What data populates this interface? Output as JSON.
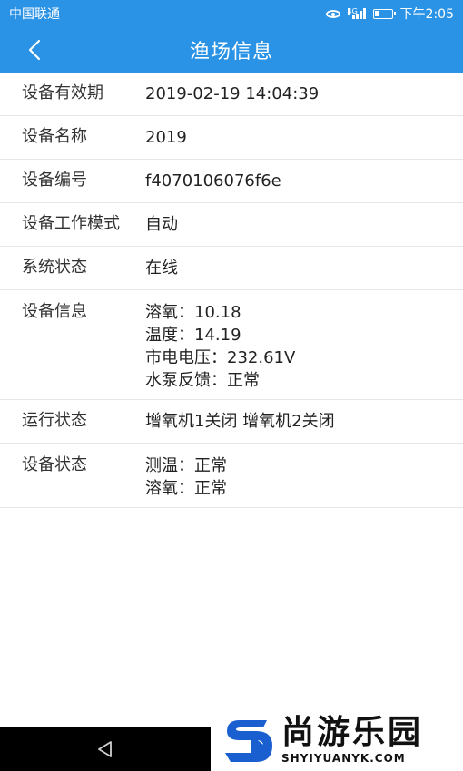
{
  "status_bar": {
    "carrier": "中国联通",
    "time": "下午2:05",
    "network": "4G"
  },
  "app_bar": {
    "title": "渔场信息",
    "back_icon": "chevron-left-icon"
  },
  "rows": [
    {
      "label": "设备有效期",
      "values": [
        "2019-02-19 14:04:39"
      ]
    },
    {
      "label": "设备名称",
      "values": [
        "2019"
      ]
    },
    {
      "label": "设备编号",
      "values": [
        "f4070106076f6e"
      ]
    },
    {
      "label": "设备工作模式",
      "values": [
        "自动"
      ]
    },
    {
      "label": "系统状态",
      "values": [
        "在线"
      ]
    },
    {
      "label": "设备信息",
      "values": [
        "溶氧：10.18",
        "温度：14.19",
        "市电电压：232.61V",
        "水泵反馈：正常"
      ]
    },
    {
      "label": "运行状态",
      "values": [
        "增氧机1关闭 增氧机2关闭"
      ]
    },
    {
      "label": "设备状态",
      "values": [
        "测温：正常",
        "溶氧：正常"
      ]
    }
  ],
  "nav_bar": {
    "back_icon": "triangle-back-icon"
  },
  "watermark": {
    "name": "尚游乐园",
    "domain": "SHYIYUANYK.COM",
    "logo_icon": "s-logo-icon"
  },
  "colors": {
    "primary": "#2b93e6",
    "divider": "#e6e6e6",
    "nav_bar": "#000000"
  }
}
